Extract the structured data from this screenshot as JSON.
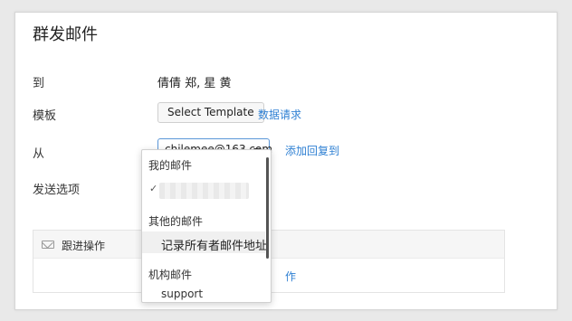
{
  "dialog": {
    "title": "群发邮件",
    "to_label": "到",
    "to_value": "倩倩 郑, 星 黄",
    "template_label": "模板",
    "template_button": "Select Template",
    "data_request_link": "数据请求",
    "from_label": "从",
    "from_value": "chilemee@163.com",
    "add_reply_to_link": "添加回复到",
    "send_options_label": "发送选项"
  },
  "followup_panel": {
    "title": "跟进操作",
    "link_tail": "作"
  },
  "from_dropdown": {
    "group_my": "我的邮件",
    "group_other": "其他的邮件",
    "other_item": "记录所有者邮件地址",
    "group_org": "机构邮件",
    "org_item": "support",
    "checkmark": "✓"
  },
  "colors": {
    "link": "#2f80d3",
    "focus_border": "#5a96d8"
  }
}
